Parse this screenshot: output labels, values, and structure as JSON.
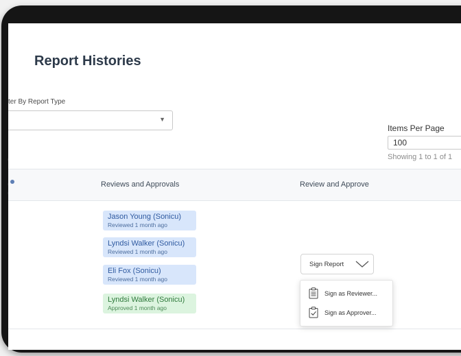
{
  "page": {
    "title": "Report Histories",
    "filter_label": "ter By Report Type",
    "filter_value": "",
    "items_per_page_label": "Items Per Page",
    "items_per_page_value": "100",
    "showing_text": "Showing 1 to 1 of 1"
  },
  "table": {
    "headers": [
      "Reviews and Approvals",
      "Review and Approve"
    ],
    "reviews": [
      {
        "name": "Jason Young (Sonicu)",
        "status": "Reviewed 1 month ago",
        "kind": "reviewed"
      },
      {
        "name": "Lyndsi Walker (Sonicu)",
        "status": "Reviewed 1 month ago",
        "kind": "reviewed"
      },
      {
        "name": "Eli Fox (Sonicu)",
        "status": "Reviewed 1 month ago",
        "kind": "reviewed"
      },
      {
        "name": "Lyndsi Walker (Sonicu)",
        "status": "Approved 1 month ago",
        "kind": "approved"
      }
    ]
  },
  "sign": {
    "button_label": "Sign Report",
    "menu": [
      {
        "label": "Sign as Reviewer...",
        "icon": "clipboard-list-icon"
      },
      {
        "label": "Sign as Approver...",
        "icon": "clipboard-check-icon"
      }
    ]
  },
  "colors": {
    "reviewed_bg": "#d8e6fb",
    "approved_bg": "#dcf4df",
    "title": "#2d3a4a"
  }
}
